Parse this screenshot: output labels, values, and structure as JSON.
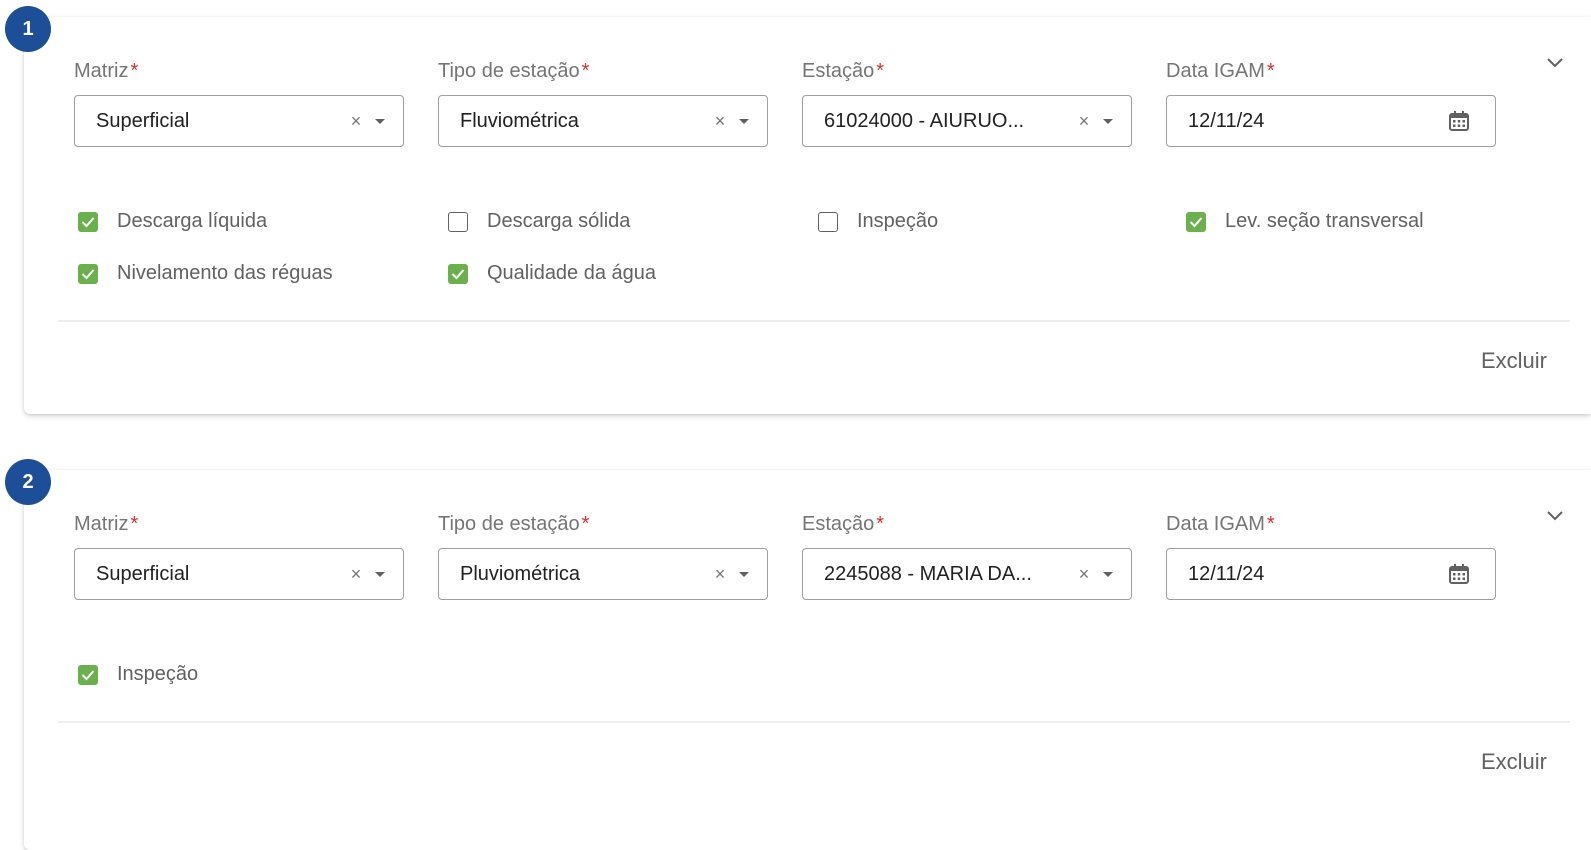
{
  "colors": {
    "badge": "#1c4f97",
    "required": "#d32f2f",
    "checked": "#6ab04c"
  },
  "cards": [
    {
      "number": "1",
      "fields": {
        "matriz": {
          "label": "Matriz",
          "required": "*",
          "value": "Superficial",
          "clear": "×"
        },
        "tipo": {
          "label": "Tipo de estação",
          "required": "*",
          "value": "Fluviométrica",
          "clear": "×"
        },
        "estacao": {
          "label": "Estação",
          "required": "*",
          "value": "61024000 - AIURUO...",
          "clear": "×"
        },
        "data": {
          "label": "Data IGAM",
          "required": "*",
          "value": "12/11/24"
        }
      },
      "checkboxes": [
        {
          "label": "Descarga líquida",
          "checked": true
        },
        {
          "label": "Descarga sólida",
          "checked": false
        },
        {
          "label": "Inspeção",
          "checked": false
        },
        {
          "label": "Lev. seção transversal",
          "checked": true
        },
        {
          "label": "Nivelamento das réguas",
          "checked": true
        },
        {
          "label": "Qualidade da água",
          "checked": true
        }
      ],
      "delete_label": "Excluir"
    },
    {
      "number": "2",
      "fields": {
        "matriz": {
          "label": "Matriz",
          "required": "*",
          "value": "Superficial",
          "clear": "×"
        },
        "tipo": {
          "label": "Tipo de estação",
          "required": "*",
          "value": "Pluviométrica",
          "clear": "×"
        },
        "estacao": {
          "label": "Estação",
          "required": "*",
          "value": "2245088 - MARIA DA...",
          "clear": "×"
        },
        "data": {
          "label": "Data IGAM",
          "required": "*",
          "value": "12/11/24"
        }
      },
      "checkboxes": [
        {
          "label": "Inspeção",
          "checked": true
        }
      ],
      "delete_label": "Excluir"
    }
  ]
}
